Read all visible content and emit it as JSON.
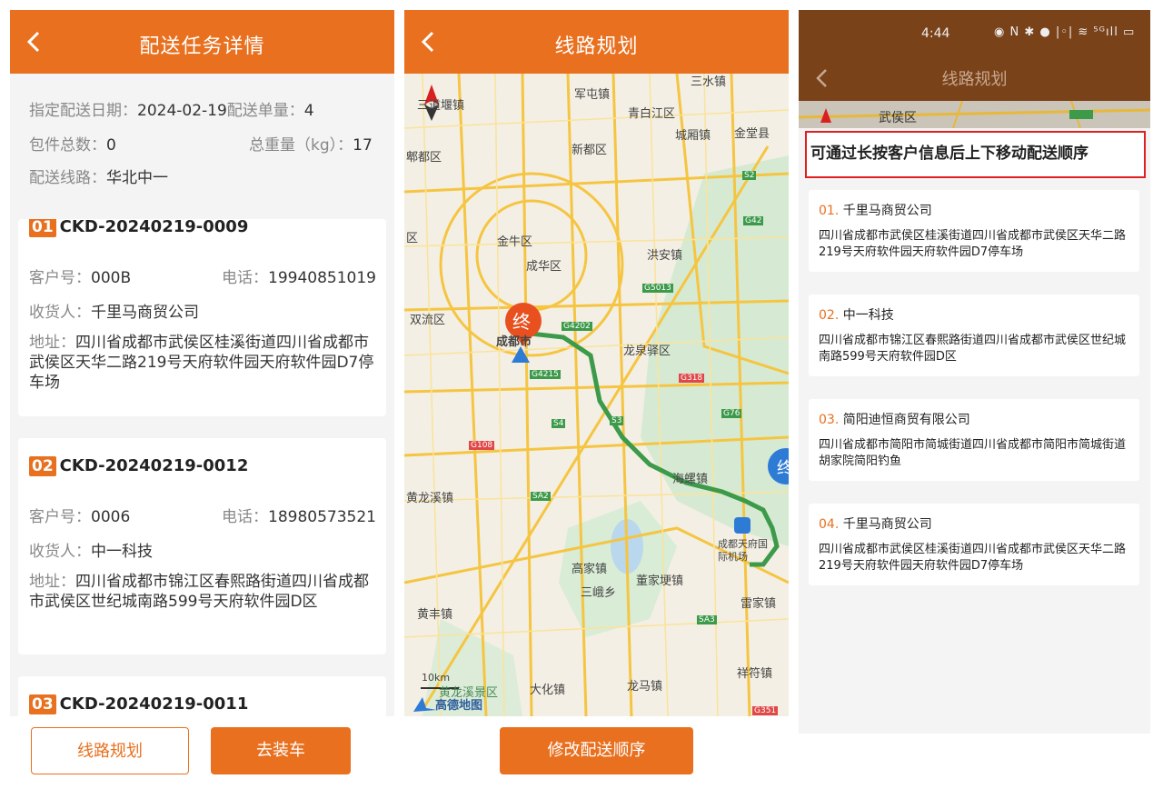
{
  "screen1": {
    "title": "配送任务详情",
    "summary": {
      "date_label": "指定配送日期：",
      "date_value": "2024-02-19",
      "count_label": "配送单量：",
      "count_value": "4",
      "pkg_label": "包件总数：",
      "pkg_value": "0",
      "weight_label": "总重量（kg）：",
      "weight_value": "17",
      "route_label": "配送线路：",
      "route_value": "华北中一"
    },
    "orders": [
      {
        "badge": "01",
        "order_no": "CKD-20240219-0009",
        "customer_label": "客户号：",
        "customer": "000B",
        "phone_label": "电话：",
        "phone": "19940851019",
        "receiver_label": "收货人：",
        "receiver": "千里马商贸公司",
        "addr_label": "地址：",
        "address": "四川省成都市武侯区桂溪街道四川省成都市武侯区天华二路219号天府软件园天府软件园D7停车场"
      },
      {
        "badge": "02",
        "order_no": "CKD-20240219-0012",
        "customer_label": "客户号：",
        "customer": "0006",
        "phone_label": "电话：",
        "phone": "18980573521",
        "receiver_label": "收货人：",
        "receiver": "中一科技",
        "addr_label": "地址：",
        "address": "四川省成都市锦江区春熙路街道四川省成都市武侯区世纪城南路599号天府软件园D区"
      },
      {
        "badge": "03",
        "order_no": "CKD-20240219-0011"
      }
    ],
    "buttons": {
      "route_plan": "线路规划",
      "go_load": "去装车"
    }
  },
  "screen2": {
    "title": "线路规划",
    "end_marker": "终",
    "map_labels": {
      "l1": "三道堰镇",
      "l2": "军屯镇",
      "l3": "三水镇",
      "l4": "青白江区",
      "l5": "郫都区",
      "l6": "新都区",
      "l7": "城厢镇",
      "l8": "金堂县",
      "l9": "金牛区",
      "l10": "成华区",
      "l11": "洪安镇",
      "l12": "双流区",
      "l13": "成都市",
      "l14": "龙泉驿区",
      "l15": "黄龙溪镇",
      "l16": "海螺镇",
      "l17": "成都天府国际机场",
      "l18": "高家镇",
      "l19": "董家埂镇",
      "l20": "三峨乡",
      "l21": "黄丰镇",
      "l22": "雷家镇",
      "l23": "祥符镇",
      "l24": "大化镇",
      "l25": "龙马镇",
      "l26": "10km",
      "l27": "高德地图",
      "l28": "区",
      "l29": "黄龙溪景区"
    },
    "road_badges": {
      "g4202": "G4202",
      "g5013": "G5013",
      "g4215": "G4215",
      "s4": "S4",
      "s3": "S3",
      "g318": "G318",
      "g76": "G76",
      "g108": "G108",
      "sa2": "SA2",
      "sa3": "SA3",
      "s2": "S2",
      "g42": "G42",
      "g351": "G351"
    },
    "button": "修改配送顺序"
  },
  "screen3": {
    "status_time": "4:44",
    "status_icons": "◉ N ✱ ● |◦| ≋ ⁵ᴳıll ▭",
    "nav_title": "线路规划",
    "map_strip_label": "武侯区",
    "hint": "可通过长按客户信息后上下移动配送顺序",
    "items": [
      {
        "num": "01.",
        "name": "千里马商贸公司",
        "address": "四川省成都市武侯区桂溪街道四川省成都市武侯区天华二路219号天府软件园天府软件园D7停车场"
      },
      {
        "num": "02.",
        "name": "中一科技",
        "address": "四川省成都市锦江区春熙路街道四川省成都市武侯区世纪城南路599号天府软件园D区"
      },
      {
        "num": "03.",
        "name": "简阳迪恒商贸有限公司",
        "address": "四川省成都市简阳市简城街道四川省成都市简阳市简城街道胡家院简阳钓鱼"
      },
      {
        "num": "04.",
        "name": "千里马商贸公司",
        "address": "四川省成都市武侯区桂溪街道四川省成都市武侯区天华二路219号天府软件园天府软件园D7停车场"
      }
    ]
  }
}
